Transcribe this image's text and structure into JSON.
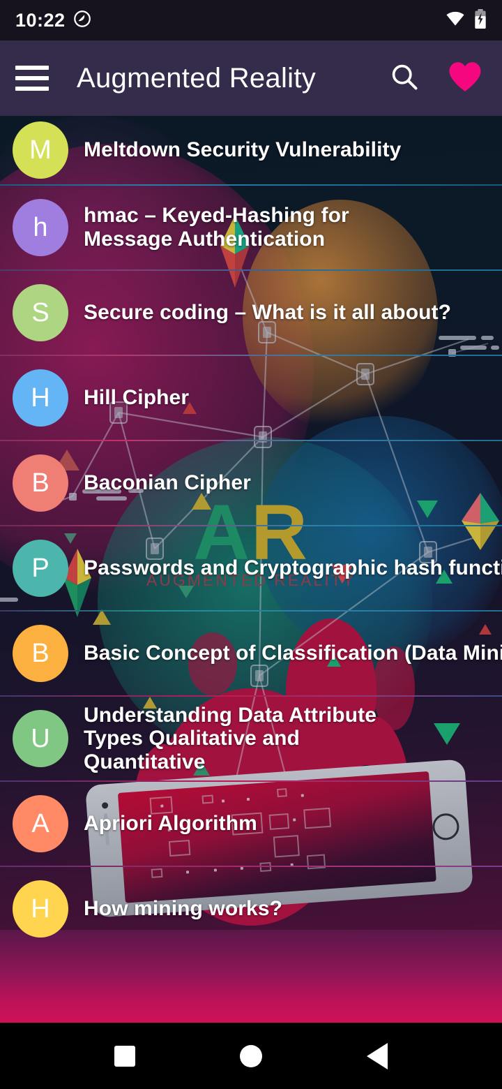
{
  "statusbar": {
    "time": "10:22",
    "icons": [
      "dnd-icon",
      "wifi-icon",
      "battery-charging-icon"
    ]
  },
  "appbar": {
    "title": "Augmented Reality",
    "menu_icon": "hamburger-menu-icon",
    "search_icon": "search-icon",
    "favorite_icon": "heart-icon",
    "background_color": "#342c4a",
    "favorite_color": "#f5087f"
  },
  "background_art": {
    "logo_primary": "AR",
    "logo_a": "A",
    "logo_r": "R",
    "logo_subtitle": "AUGMENTED REALITY",
    "logo_a_color": "#1d8a63",
    "logo_r_color": "#b49a2c",
    "logo_subtitle_color": "#8c3b4a"
  },
  "list": {
    "items": [
      {
        "initial": "M",
        "color": "#d4e157",
        "title": "Meltdown Security Vulnerability"
      },
      {
        "initial": "h",
        "color": "#a07ee0",
        "title": "hmac – Keyed-Hashing for Message Authentication"
      },
      {
        "initial": "S",
        "color": "#aed581",
        "title": "Secure coding – What is it all about?"
      },
      {
        "initial": "H",
        "color": "#64b5f6",
        "title": "Hill Cipher"
      },
      {
        "initial": "B",
        "color": "#ef7e75",
        "title": "Baconian Cipher"
      },
      {
        "initial": "P",
        "color": "#4db6ac",
        "title": "Passwords and Cryptographic hash function"
      },
      {
        "initial": "B",
        "color": "#fbb03f",
        "title": "Basic Concept of Classification (Data Mining)"
      },
      {
        "initial": "U",
        "color": "#81c784",
        "title": "Understanding Data Attribute Types Qualitative and Quantitative"
      },
      {
        "initial": "A",
        "color": "#ff8a65",
        "title": "Apriori Algorithm"
      },
      {
        "initial": "H",
        "color": "#ffd54f",
        "title": "How mining works?"
      }
    ]
  },
  "navbar": {
    "recents_label": "recents-button",
    "home_label": "home-button",
    "back_label": "back-button"
  }
}
